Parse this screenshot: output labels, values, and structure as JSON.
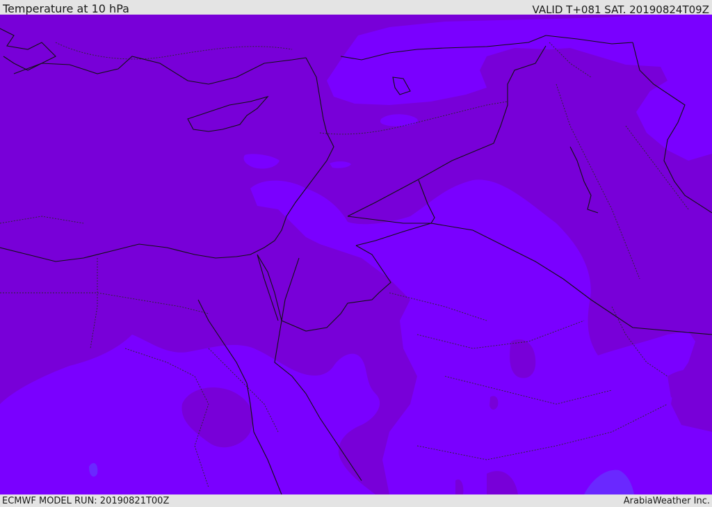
{
  "header": {
    "title": "Temperature at 10 hPa",
    "valid_time": "VALID T+081 SAT. 20190824T09Z"
  },
  "footer": {
    "model_run": "ECMWF MODEL RUN: 20190821T00Z",
    "credit": "ArabiaWeather Inc."
  },
  "map": {
    "field": "temperature",
    "pressure_level_hpa": 10,
    "colors": {
      "fill_warmer": "#7800d8",
      "fill_colder": "#7a00ff",
      "fill_coldest": "#6a28ff",
      "coastline": "#111111",
      "borders": "#333333"
    }
  }
}
